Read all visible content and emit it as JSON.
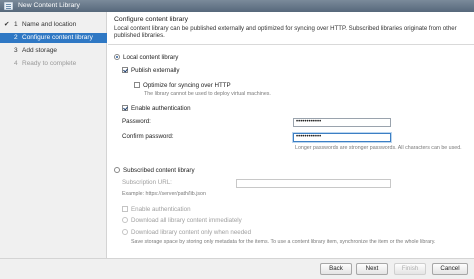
{
  "window": {
    "title": "New Content Library"
  },
  "steps": [
    {
      "check": "✔",
      "num": "1",
      "label": "Name and location"
    },
    {
      "check": "",
      "num": "2",
      "label": "Configure content library"
    },
    {
      "check": "",
      "num": "3",
      "label": "Add storage"
    },
    {
      "check": "",
      "num": "4",
      "label": "Ready to complete"
    }
  ],
  "content": {
    "title": "Configure content library",
    "description": "Local content library can be published externally and optimized for syncing over HTTP. Subscribed libraries originate from other published libraries."
  },
  "local": {
    "radio_label": "Local content library",
    "publish_label": "Publish externally",
    "optimize_label": "Optimize for syncing over HTTP",
    "optimize_hint": "The library cannot be used to deploy virtual machines.",
    "auth_label": "Enable authentication",
    "password_label": "Password:",
    "password_value": "••••••••••••",
    "confirm_label": "Confirm password:",
    "confirm_value": "••••••••••••",
    "password_hint": "Longer passwords are stronger passwords. All characters can be used."
  },
  "subscribed": {
    "radio_label": "Subscribed content library",
    "url_label": "Subscription URL:",
    "url_example": "Example: https://server/path/lib.json",
    "auth_label": "Enable authentication",
    "download_all_label": "Download all library content immediately",
    "download_needed_label": "Download library content only when needed",
    "download_needed_hint": "Save storage space by storing only metadata for the items. To use a content library item, synchronize the item or the whole library."
  },
  "footer": {
    "back": "Back",
    "next": "Next",
    "finish": "Finish",
    "cancel": "Cancel"
  }
}
